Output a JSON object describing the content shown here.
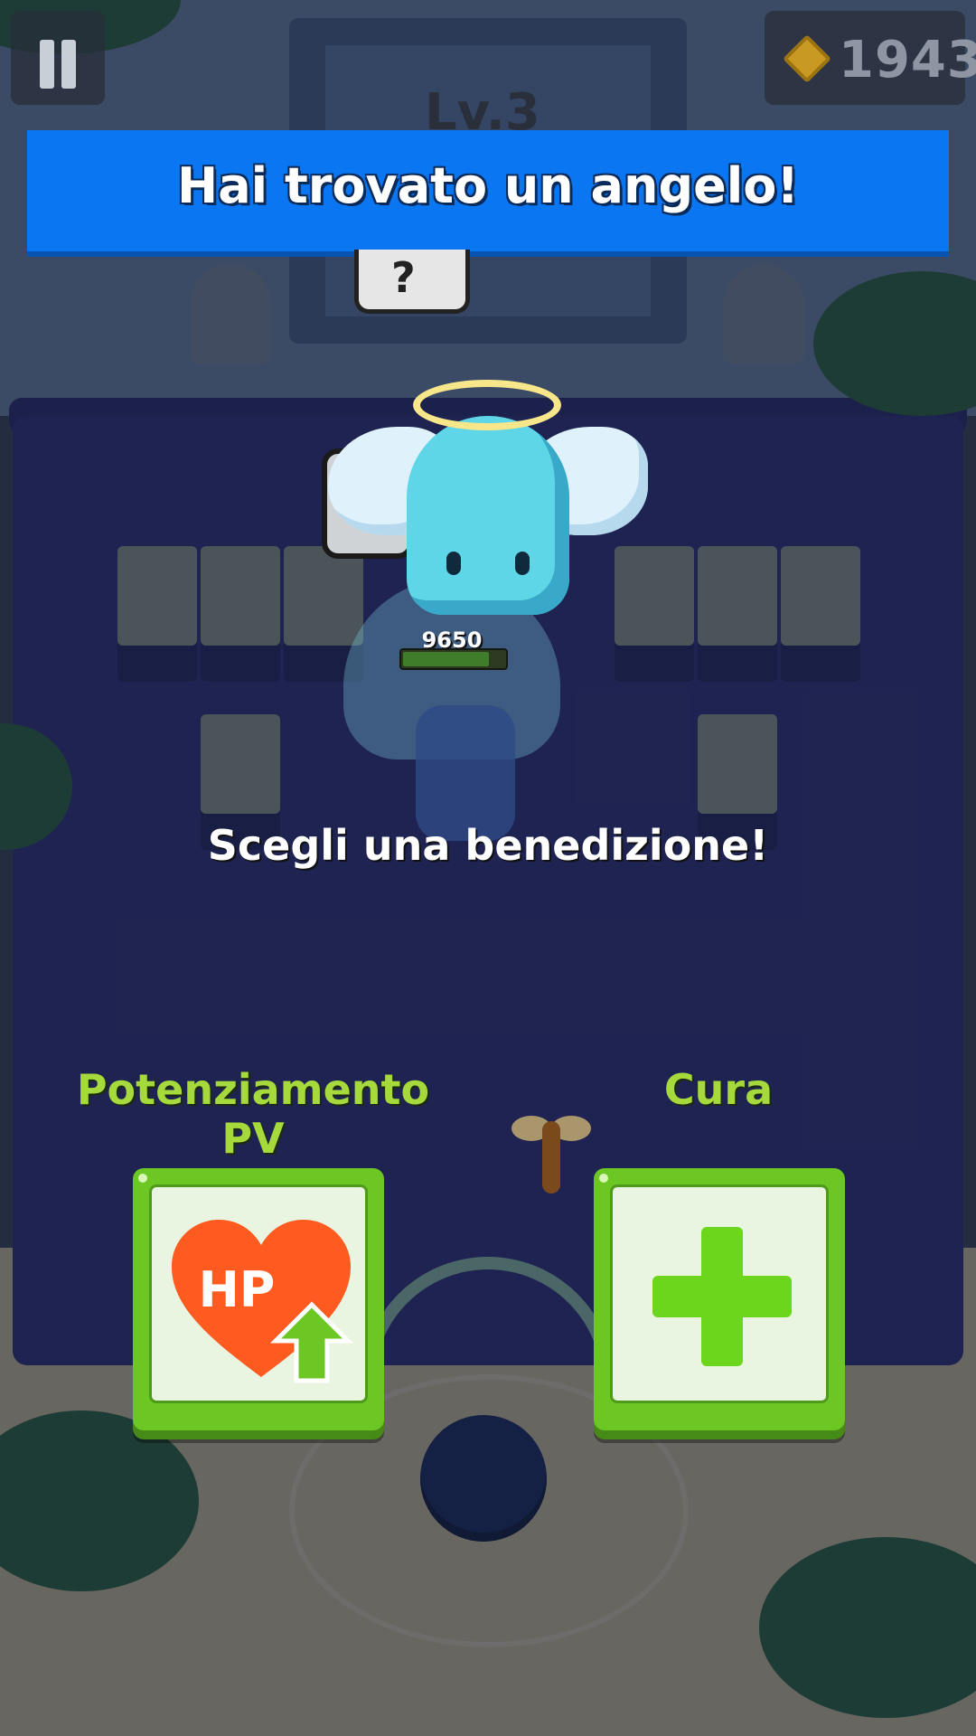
{
  "hud": {
    "coins": "1943",
    "coin_icon": "diamond-coin-icon",
    "pause_icon": "pause-icon"
  },
  "level": {
    "label": "Lv.3"
  },
  "banner": {
    "title": "Hai trovato un angelo!"
  },
  "bubble": {
    "text": "?"
  },
  "boss": {
    "hp_value": "9650",
    "hp_fraction": 0.85
  },
  "prompt": {
    "text": "Scegli una benedizione!"
  },
  "options": [
    {
      "label": "Potenziamento PV",
      "icon": "hp-boost-heart-icon",
      "icon_text": "HP"
    },
    {
      "label": "Cura",
      "icon": "heal-plus-icon"
    }
  ],
  "colors": {
    "banner": "#0b76f2",
    "option_label": "#a6d93c",
    "card_green": "#6cc624",
    "heart": "#ff5a1f",
    "arrow": "#6cc624"
  }
}
